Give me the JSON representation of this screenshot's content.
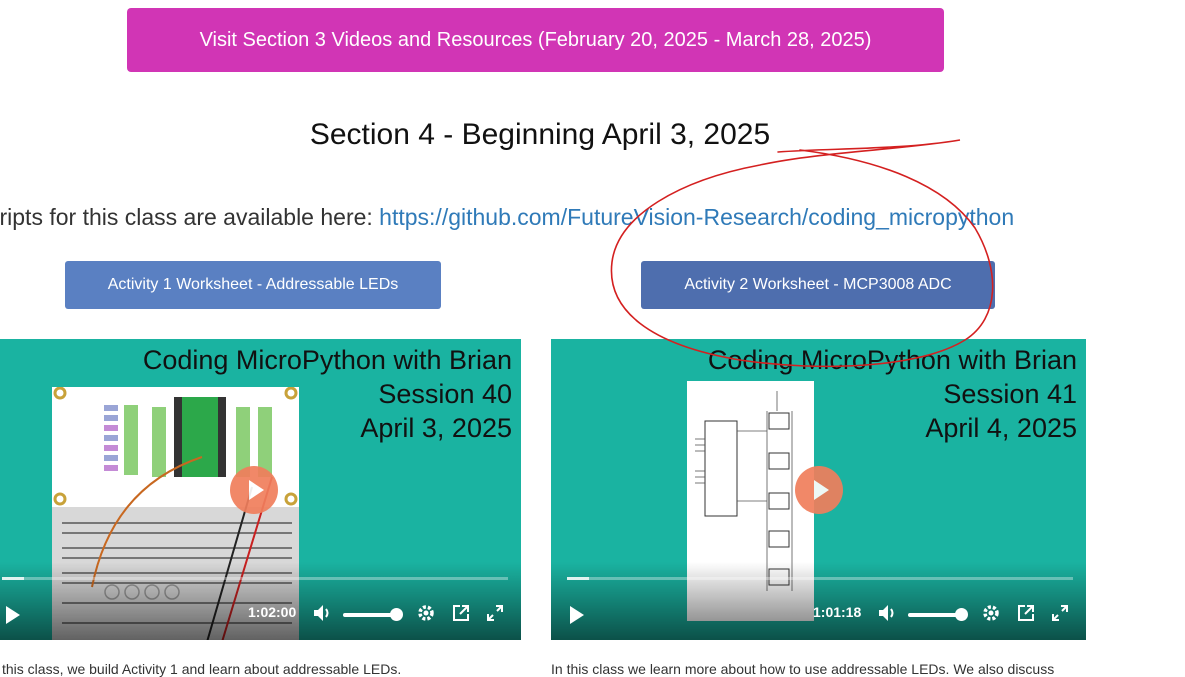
{
  "top_button": {
    "label": "Visit Section 3 Videos and Resources (February 20, 2025 - March 28, 2025)"
  },
  "section": {
    "heading": "Section 4 - Beginning April 3, 2025"
  },
  "scripts": {
    "prefix": "cripts for this class are available here: ",
    "link": "https://github.com/FutureVision-Research/coding_micropython"
  },
  "worksheets": [
    {
      "label": "Activity 1 Worksheet - Addressable LEDs"
    },
    {
      "label": "Activity 2 Worksheet - MCP3008 ADC"
    }
  ],
  "videos": [
    {
      "title_lines": [
        "Coding MicroPython with Brian",
        "Session 40",
        "April 3, 2025"
      ],
      "duration": "1:02:00",
      "volume": 0.9,
      "description": "this class, we build Activity 1 and learn about addressable LEDs."
    },
    {
      "title_lines": [
        "Coding MicroPython with Brian",
        "Session 41",
        "April 4, 2025"
      ],
      "duration": "1:01:18",
      "volume": 0.9,
      "description": "In this class we learn more about how to use addressable LEDs. We also discuss"
    }
  ],
  "icons": [
    "play-icon",
    "volume-icon",
    "settings-gear-icon",
    "popout-icon",
    "fullscreen-icon"
  ],
  "colors": {
    "top_button": "#d135b5",
    "worksheet_button": "#5a80c2",
    "video_background": "#1ab3a1",
    "play_button": "#f07e5c",
    "link": "#2f7ab8",
    "annotation": "#d42020"
  }
}
